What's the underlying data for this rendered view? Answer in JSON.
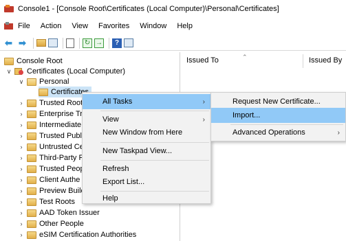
{
  "window": {
    "title": "Console1 - [Console Root\\Certificates (Local Computer)\\Personal\\Certificates]"
  },
  "menubar": {
    "items": [
      "File",
      "Action",
      "View",
      "Favorites",
      "Window",
      "Help"
    ]
  },
  "toolbar": {
    "icons": [
      "back-arrow-icon",
      "forward-arrow-icon",
      "up-folder-icon",
      "show-hide-tree-icon",
      "properties-icon",
      "refresh-icon",
      "export-list-icon",
      "help-icon",
      "action-pane-icon"
    ]
  },
  "tree": {
    "root": "Console Root",
    "certs": "Certificates (Local Computer)",
    "personal": "Personal",
    "certificates": "Certificates",
    "folders": [
      "Trusted Root",
      "Enterprise Tr",
      "Intermediate",
      "Trusted Publ",
      "Untrusted Ce",
      "Third-Party F",
      "Trusted Peop",
      "Client Authe",
      "Preview Builc",
      "Test Roots",
      "AAD Token Issuer",
      "Other People",
      "eSIM Certification Authorities"
    ]
  },
  "list": {
    "col_issued_to": "Issued To",
    "col_issued_by": "Issued By"
  },
  "context_menu": {
    "all_tasks": "All Tasks",
    "view": "View",
    "new_window": "New Window from Here",
    "new_taskpad": "New Taskpad View...",
    "refresh": "Refresh",
    "export_list": "Export List...",
    "help": "Help"
  },
  "submenu": {
    "request_new": "Request New Certificate...",
    "import": "Import...",
    "advanced": "Advanced Operations"
  },
  "colors": {
    "highlight": "#91c9f7",
    "menu_bg": "#f2f2f2",
    "selection": "#cce4f7"
  }
}
